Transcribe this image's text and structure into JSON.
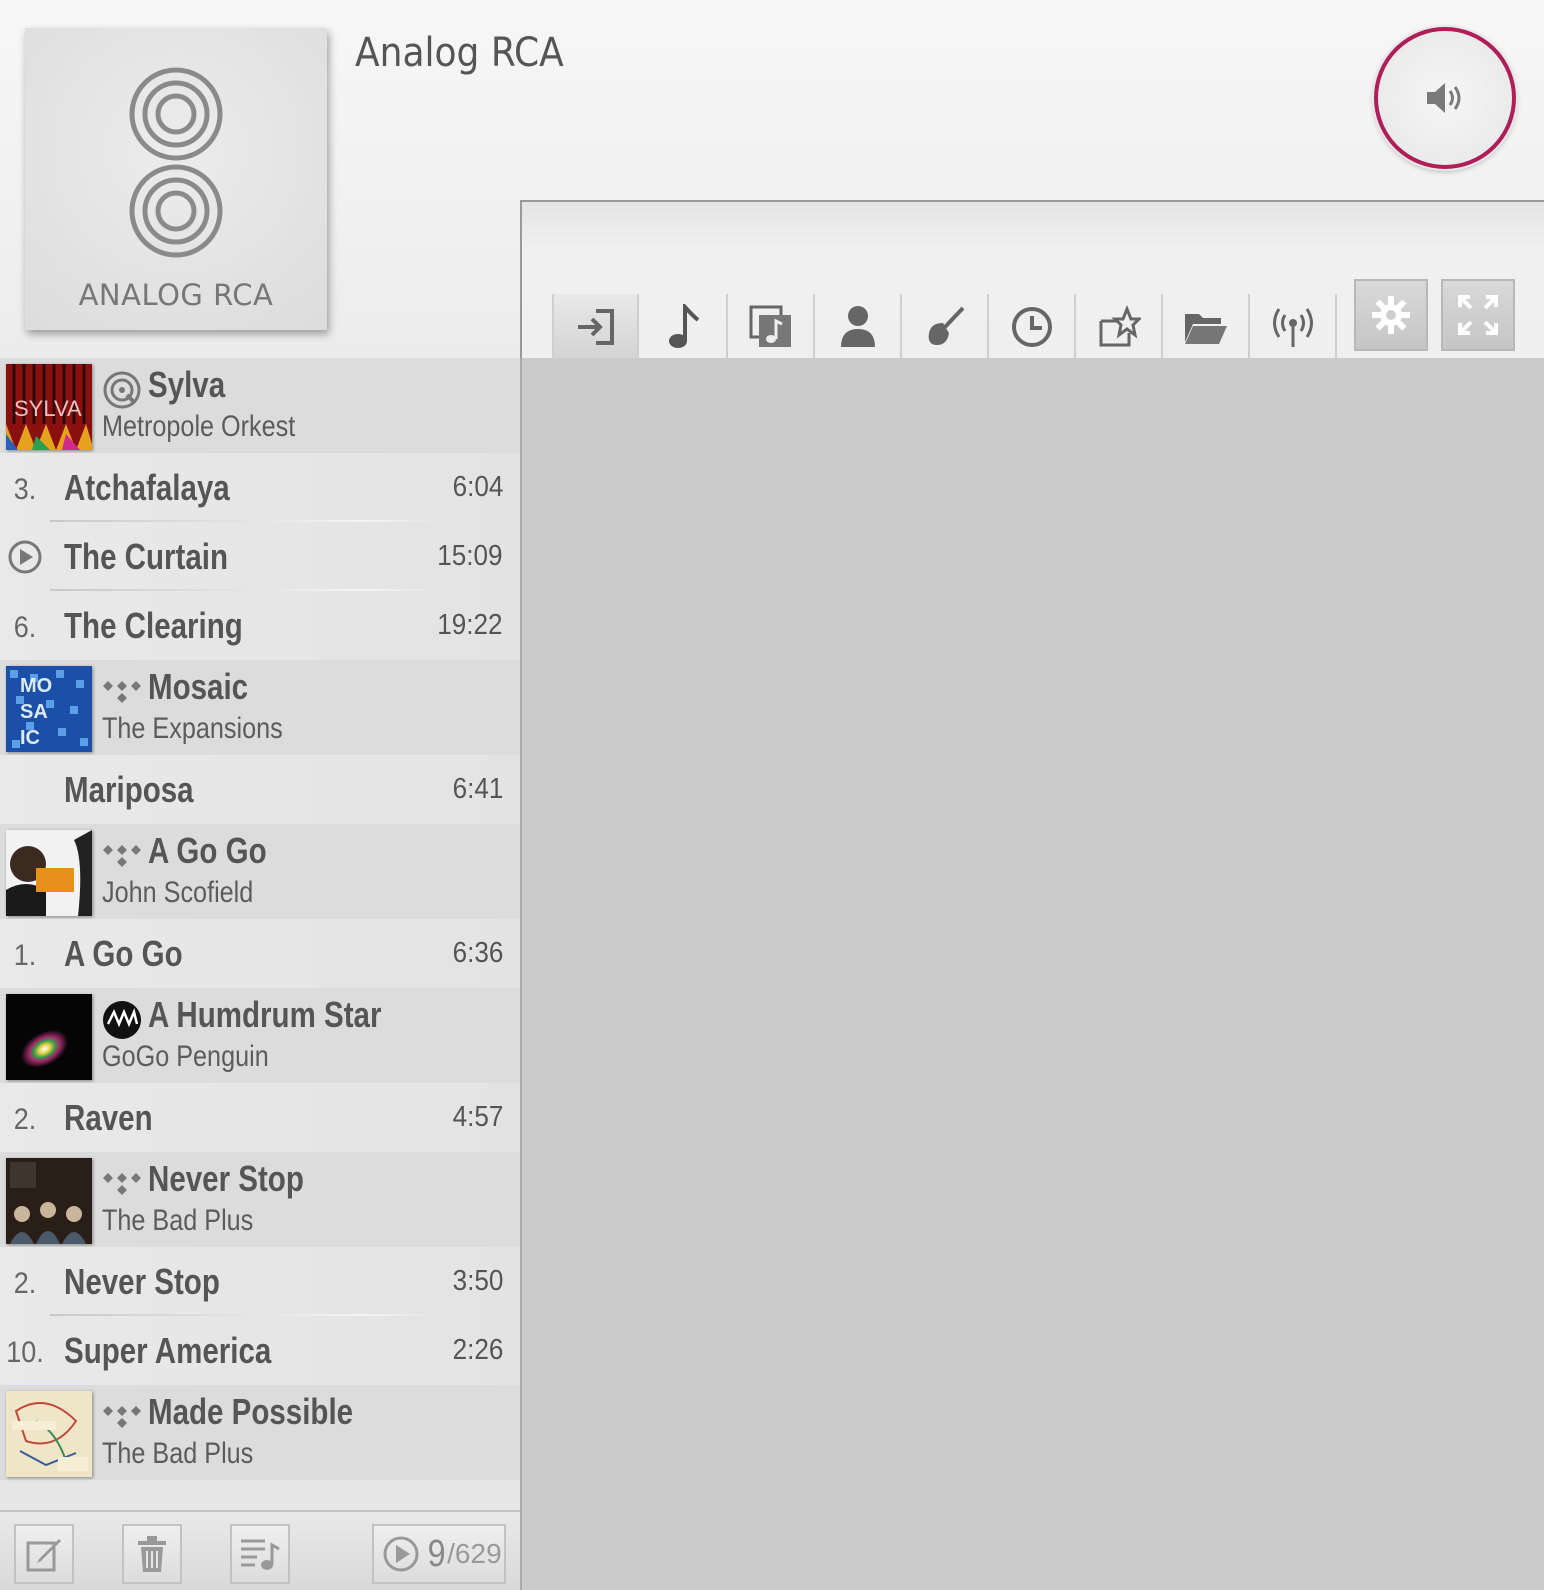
{
  "zone": {
    "title": "Analog RCA",
    "source_art_label": "ANALOG RCA",
    "accent_color": "#b01e5a"
  },
  "toolbar": {
    "tabs": [
      {
        "name": "input-icon",
        "active": true
      },
      {
        "name": "music-note-icon"
      },
      {
        "name": "albums-icon"
      },
      {
        "name": "artist-icon"
      },
      {
        "name": "genre-guitar-icon"
      },
      {
        "name": "history-clock-icon"
      },
      {
        "name": "favorites-star-icon"
      },
      {
        "name": "folder-icon"
      },
      {
        "name": "radio-icon"
      }
    ],
    "buttons": [
      {
        "name": "settings-gear-icon"
      },
      {
        "name": "fullscreen-icon"
      }
    ]
  },
  "queue": {
    "rows": [
      {
        "type": "album",
        "title": "Sylva",
        "artist": "Metropole Orkest",
        "service": "disc-icon"
      },
      {
        "type": "track",
        "num": "3.",
        "title": "Atchafalaya",
        "duration": "6:04"
      },
      {
        "type": "track",
        "num": "",
        "playing": true,
        "title": "The Curtain",
        "duration": "15:09"
      },
      {
        "type": "track",
        "num": "6.",
        "title": "The Clearing",
        "duration": "19:22"
      },
      {
        "type": "album",
        "title": "Mosaic",
        "artist": "The Expansions",
        "service": "tidal-icon"
      },
      {
        "type": "track",
        "num": "",
        "title": "Mariposa",
        "duration": "6:41"
      },
      {
        "type": "album",
        "title": "A Go Go",
        "artist": "John Scofield",
        "service": "tidal-icon"
      },
      {
        "type": "track",
        "num": "1.",
        "title": "A Go Go",
        "duration": "6:36"
      },
      {
        "type": "album",
        "title": "A Humdrum Star",
        "artist": "GoGo Penguin",
        "service": "airable-icon"
      },
      {
        "type": "track",
        "num": "2.",
        "title": "Raven",
        "duration": "4:57"
      },
      {
        "type": "album",
        "title": "Never Stop",
        "artist": "The Bad Plus",
        "service": "tidal-icon"
      },
      {
        "type": "track",
        "num": "2.",
        "title": "Never Stop",
        "duration": "3:50"
      },
      {
        "type": "track",
        "num": "10.",
        "title": "Super America",
        "duration": "2:26"
      },
      {
        "type": "album",
        "title": "Made Possible",
        "artist": "The Bad Plus",
        "service": "tidal-icon"
      }
    ]
  },
  "footer": {
    "current": "9",
    "total": "/629"
  }
}
